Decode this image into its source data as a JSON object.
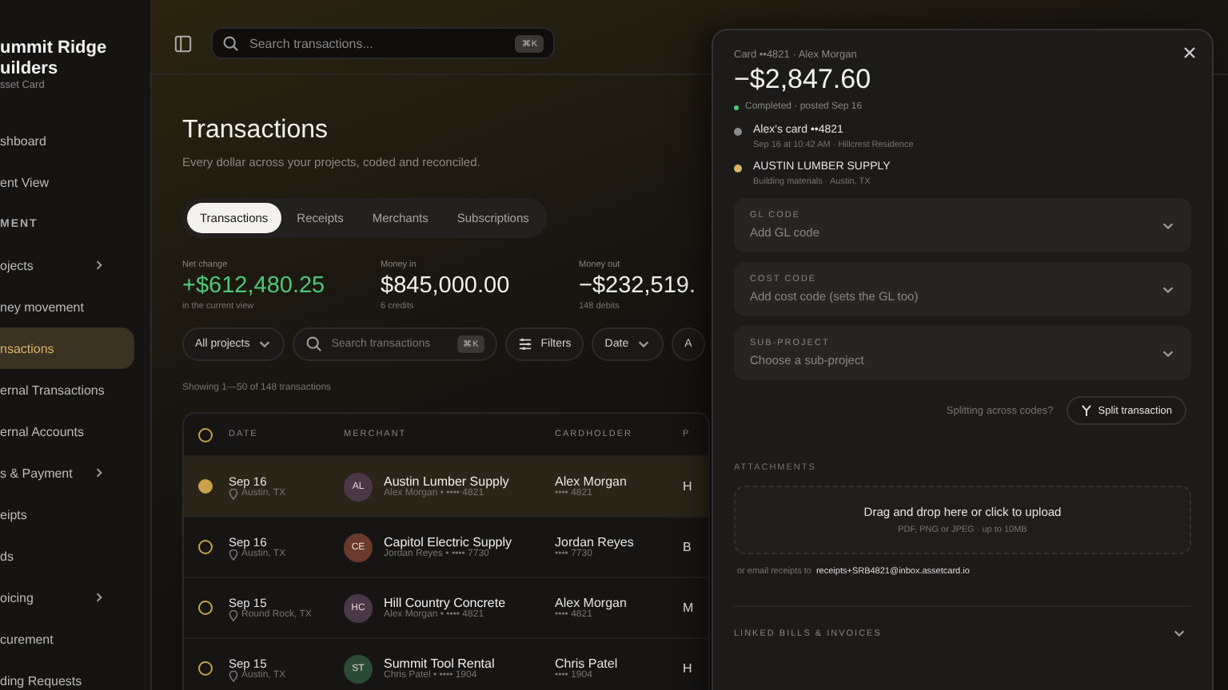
{
  "sidebar": {
    "org_name": [
      "ummit Ridge",
      "uilders"
    ],
    "org_subtitle": "sset Card",
    "items": [
      {
        "kind": "link",
        "label": "shboard",
        "selected": false,
        "expandable": false
      },
      {
        "kind": "link",
        "label": "ent View",
        "selected": false,
        "expandable": false
      },
      {
        "kind": "section",
        "label": "MENT"
      },
      {
        "kind": "link",
        "label": "ojects",
        "selected": false,
        "expandable": true
      },
      {
        "kind": "link",
        "label": "ney movement",
        "selected": false,
        "expandable": false
      },
      {
        "kind": "link",
        "label": "nsactions",
        "selected": true,
        "expandable": false
      },
      {
        "kind": "link",
        "label": "ernal Transactions",
        "selected": false,
        "expandable": false
      },
      {
        "kind": "link",
        "label": "ernal Accounts",
        "selected": false,
        "expandable": false
      },
      {
        "kind": "link",
        "label": "s & Payment",
        "selected": false,
        "expandable": true
      },
      {
        "kind": "link",
        "label": "eipts",
        "selected": false,
        "expandable": false
      },
      {
        "kind": "link",
        "label": "ds",
        "selected": false,
        "expandable": false
      },
      {
        "kind": "link",
        "label": "oicing",
        "selected": false,
        "expandable": true
      },
      {
        "kind": "link",
        "label": "curement",
        "selected": false,
        "expandable": false
      },
      {
        "kind": "link",
        "label": "ding Requests",
        "selected": false,
        "expandable": false
      }
    ]
  },
  "topbar": {
    "search_placeholder": "Search transactions...",
    "shortcut": "⌘K"
  },
  "page": {
    "title": "Transactions",
    "subtitle": "Every dollar across your projects, coded and reconciled.",
    "tabs": [
      {
        "label": "Transactions",
        "selected": true
      },
      {
        "label": "Receipts",
        "selected": false
      },
      {
        "label": "Merchants",
        "selected": false
      },
      {
        "label": "Subscriptions",
        "selected": false
      }
    ],
    "stats": [
      {
        "label": "Net change",
        "value": "+$612,480.25",
        "note": "in the current view",
        "color": "#4cc878"
      },
      {
        "label": "Money in",
        "value": "$845,000.00",
        "note": "6 credits",
        "color": "#f2f0ec"
      },
      {
        "label": "Money out",
        "value": "−$232,519.",
        "note": "148 debits",
        "color": "#f2f0ec"
      }
    ],
    "filters": {
      "project": "All projects",
      "search_placeholder": "Search transactions",
      "shortcut": "⌘K",
      "buttons": [
        {
          "kind": "filters",
          "label": "Filters"
        },
        {
          "kind": "dropdown",
          "label": "Date"
        },
        {
          "kind": "plain",
          "label": "A"
        }
      ]
    },
    "showing": "Showing 1—50 of 148 transactions"
  },
  "table": {
    "select_all": {
      "selected": false
    },
    "columns": [
      "DATE",
      "MERCHANT",
      "CARDHOLDER",
      "P"
    ],
    "rows": [
      {
        "selected": true,
        "date": "Sep 16",
        "location": "Austin, TX",
        "initials": "AL",
        "color": "#4a3848",
        "merchant": "Austin Lumber Supply",
        "merchant_sub": "Alex Morgan • •••• 4821",
        "cardholder": "Alex Morgan",
        "card": "•••• 4821",
        "column_5": "H"
      },
      {
        "selected": false,
        "date": "Sep 16",
        "location": "Austin, TX",
        "initials": "CE",
        "color": "#6a3a2c",
        "merchant": "Capitol Electric Supply",
        "merchant_sub": "Jordan Reyes • •••• 7730",
        "cardholder": "Jordan Reyes",
        "card": "•••• 7730",
        "column_5": "B"
      },
      {
        "selected": false,
        "date": "Sep 15",
        "location": "Round Rock, TX",
        "initials": "HC",
        "color": "#4a3848",
        "merchant": "Hill Country Concrete",
        "merchant_sub": "Alex Morgan • •••• 4821",
        "cardholder": "Alex Morgan",
        "card": "•••• 4821",
        "column_5": "M"
      },
      {
        "selected": false,
        "date": "Sep 15",
        "location": "Austin, TX",
        "initials": "ST",
        "color": "#2c4a34",
        "merchant": "Summit Tool Rental",
        "merchant_sub": "Chris Patel • •••• 1904",
        "cardholder": "Chris Patel",
        "card": "•••• 1904",
        "column_5": "H"
      }
    ]
  },
  "drawer": {
    "card_line": "Card ••4821 · Alex Morgan",
    "amount": "−$2,847.60",
    "status": "Completed · posted Sep 16",
    "timeline": [
      {
        "title": "Alex's card ••4821",
        "detail": "Sep 16 at 10:42 AM · Hillcrest Residence",
        "color": "#8a8a8a"
      },
      {
        "title": "AUSTIN LUMBER SUPPLY",
        "detail": "Building materials · Austin, TX",
        "color": "#d9b26a"
      }
    ],
    "fields": [
      {
        "label": "GL CODE",
        "placeholder": "Add GL code"
      },
      {
        "label": "COST CODE",
        "placeholder": "Add cost code (sets the GL too)"
      },
      {
        "label": "SUB-PROJECT",
        "placeholder": "Choose a sub-project"
      }
    ],
    "split_hint": "Splitting across codes?",
    "split_button": "Split transaction",
    "attachments_label": "ATTACHMENTS",
    "upload_title": "Drag and drop here or click to upload",
    "upload_hint": "PDF, PNG or JPEG · up to 10MB",
    "email_prefix": "or email receipts to",
    "email": "receipts+SRB4821@inbox.assetcard.io",
    "linked_label": "LINKED BILLS & INVOICES"
  }
}
